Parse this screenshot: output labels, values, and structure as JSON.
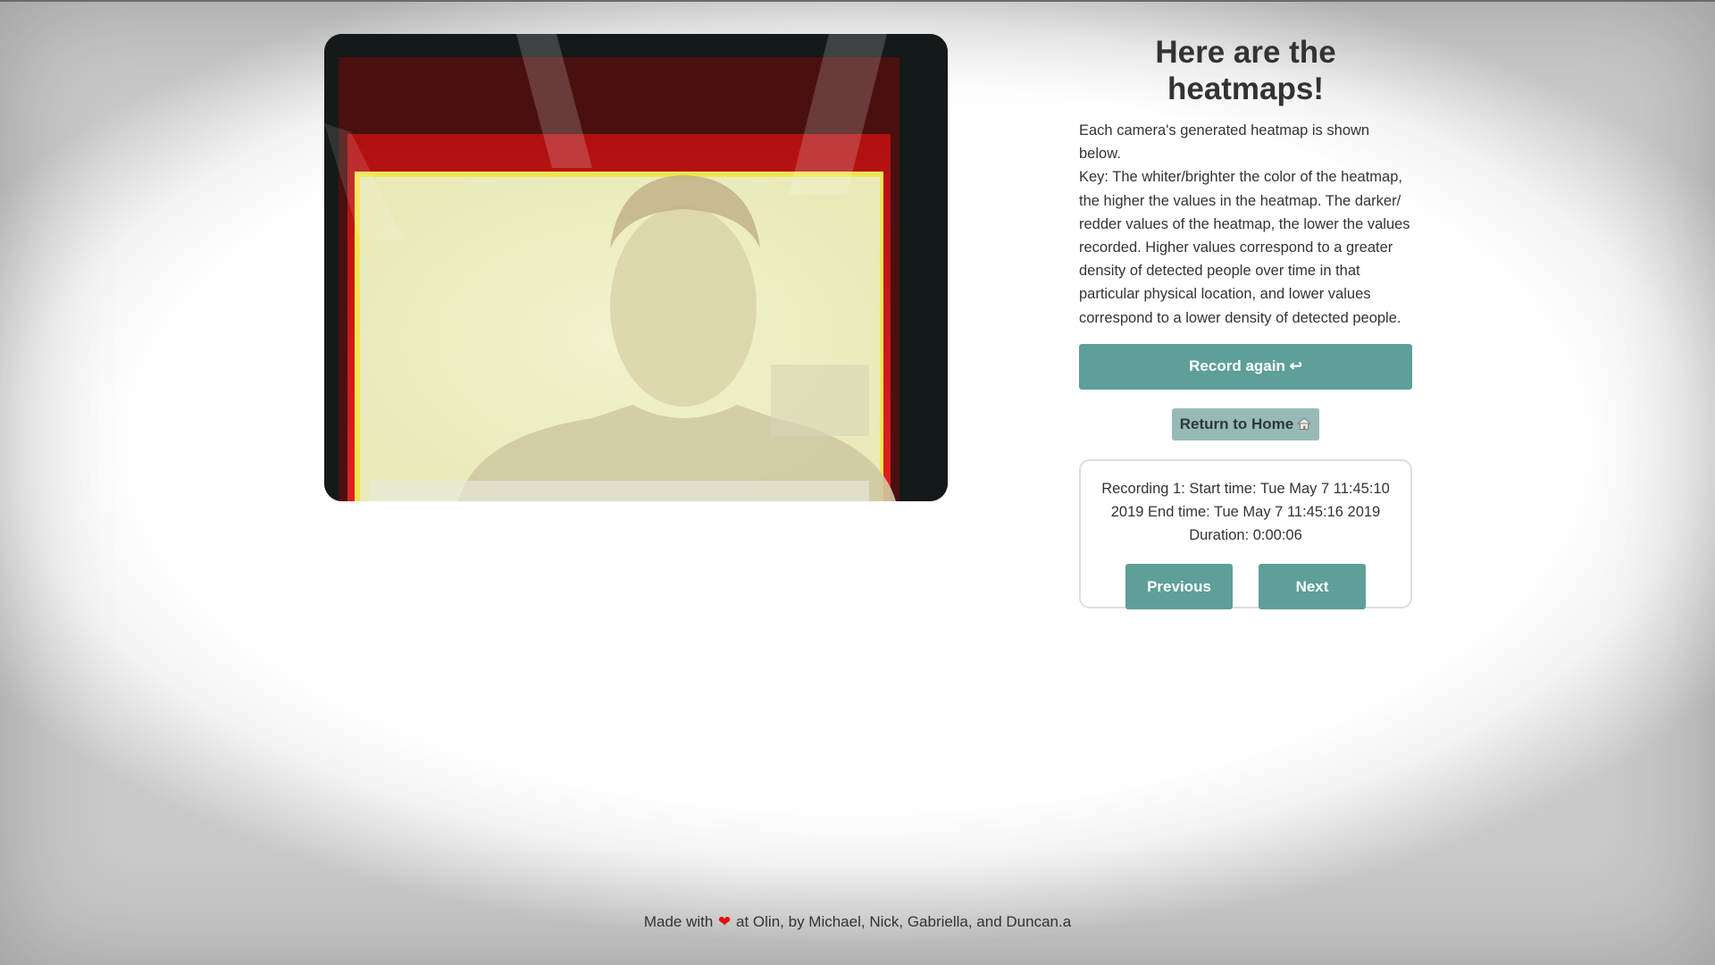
{
  "header": {
    "title": "Here are the heatmaps!"
  },
  "description": {
    "intro": "Each camera's generated heatmap is shown below.",
    "key": "Key: The whiter/brighter the color of the heatmap, the higher the values in the heatmap. The darker/ redder values of the heatmap, the lower the values recorded. Higher values correspond to a greater density of detected people over time in that particular physical location, and lower values correspond to a lower density of detected people."
  },
  "actions": {
    "record_again_label": "Record again ↩",
    "return_home_label": "Return to Home",
    "return_home_icon": "home-icon"
  },
  "recording": {
    "info": "Recording 1: Start time: Tue May 7 11:45:10 2019 End time: Tue May 7 11:45:16 2019 Duration: 0:00:06",
    "previous_label": "Previous",
    "next_label": "Next"
  },
  "footer": {
    "prefix": "Made with",
    "heart_icon": "heart-icon",
    "suffix": "at Olin, by Michael, Nick, Gabriella, and Duncan.a"
  },
  "colors": {
    "button_primary": "#5f9f99",
    "button_secondary": "#97bab7",
    "heart": "#e01010",
    "text": "#333333"
  }
}
